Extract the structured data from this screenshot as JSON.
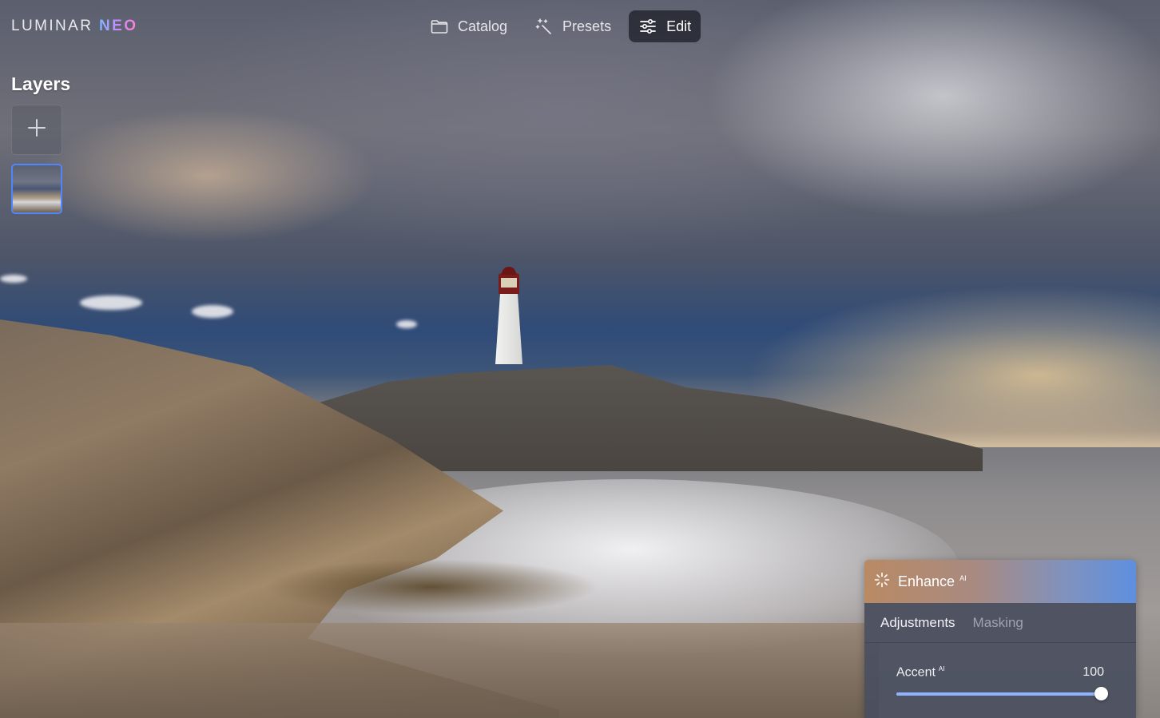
{
  "app": {
    "brand_primary": "LUMINAR",
    "brand_secondary": "NEO"
  },
  "nav": {
    "catalog": {
      "label": "Catalog",
      "icon": "folder-icon"
    },
    "presets": {
      "label": "Presets",
      "icon": "magic-wand-icon"
    },
    "edit": {
      "label": "Edit",
      "icon": "sliders-icon",
      "active": true
    }
  },
  "layers": {
    "title": "Layers",
    "add_icon": "plus-icon"
  },
  "panel": {
    "title": "Enhance",
    "title_badge": "AI",
    "icon": "sparkle-icon",
    "tabs": {
      "adjustments": "Adjustments",
      "masking": "Masking"
    },
    "active_tab": "Adjustments",
    "slider": {
      "label": "Accent",
      "label_badge": "AI",
      "value": 100,
      "value_text": "100",
      "fraction": 1.0
    }
  },
  "colors": {
    "accent": "#4f86ff",
    "panel_header_start": "#b98a64",
    "panel_header_end": "#5e8fe0"
  }
}
